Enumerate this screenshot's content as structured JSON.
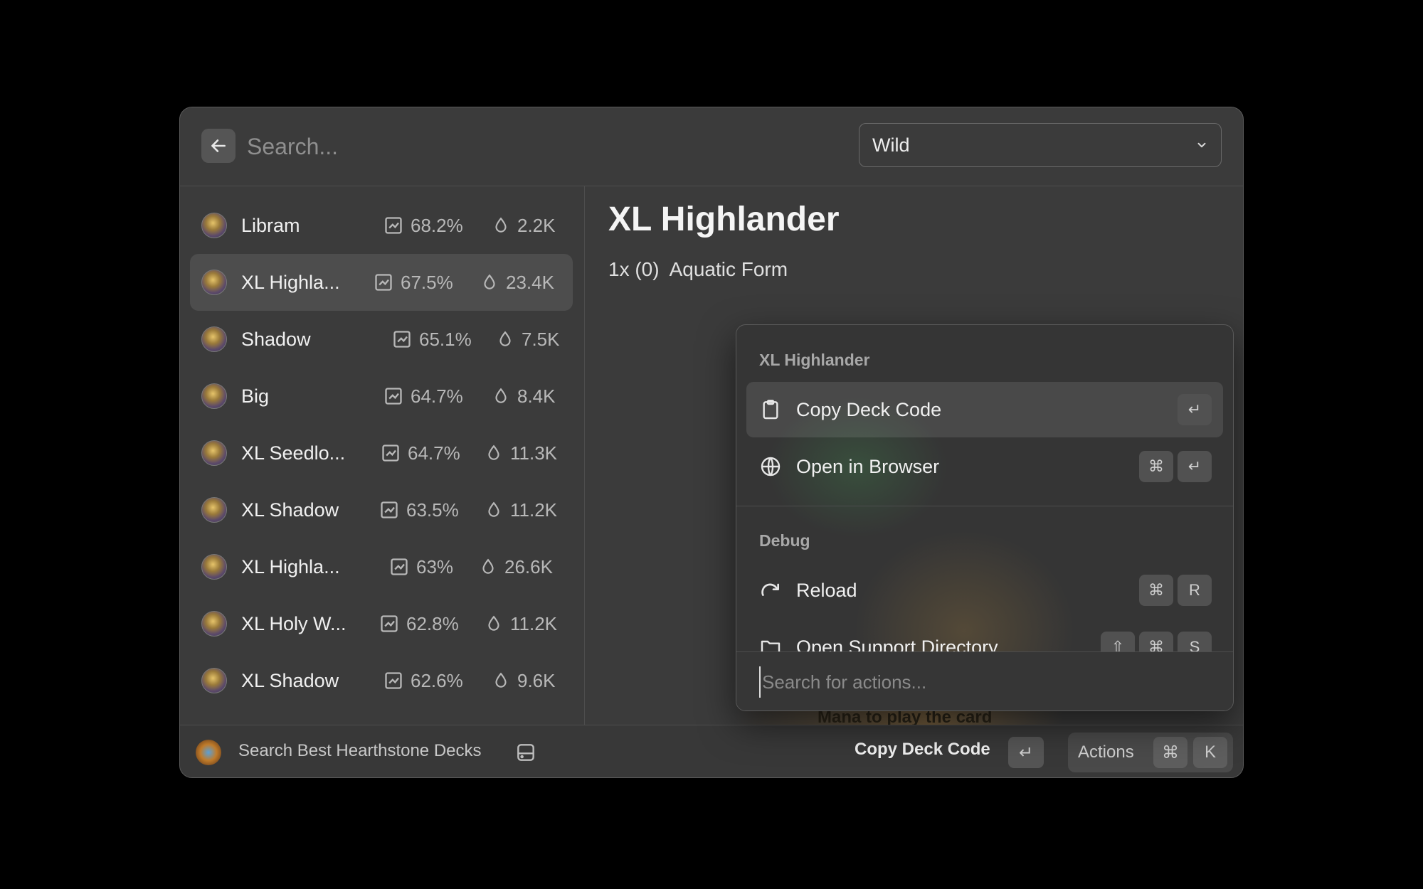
{
  "header": {
    "search_placeholder": "Search...",
    "dropdown_value": "Wild"
  },
  "decks": [
    {
      "name": "Libram",
      "winrate": "68.2%",
      "games": "2.2K"
    },
    {
      "name": "XL Highla...",
      "winrate": "67.5%",
      "games": "23.4K",
      "selected": true
    },
    {
      "name": "Shadow",
      "winrate": "65.1%",
      "games": "7.5K"
    },
    {
      "name": "Big",
      "winrate": "64.7%",
      "games": "8.4K"
    },
    {
      "name": "XL Seedlo...",
      "winrate": "64.7%",
      "games": "11.3K"
    },
    {
      "name": "XL Shadow",
      "winrate": "63.5%",
      "games": "11.2K"
    },
    {
      "name": "XL Highla...",
      "winrate": "63%",
      "games": "26.6K"
    },
    {
      "name": "XL Holy W...",
      "winrate": "62.8%",
      "games": "11.2K"
    },
    {
      "name": "XL Shadow",
      "winrate": "62.6%",
      "games": "9.6K"
    }
  ],
  "detail": {
    "title": "XL Highlander",
    "line": "1x (0)  Aquatic Form",
    "card_peek_text": "Mana to play the card"
  },
  "popover": {
    "section1": "XL Highlander",
    "items1": [
      {
        "label": "Copy Deck Code",
        "keys": [
          "↵"
        ]
      },
      {
        "label": "Open in Browser",
        "keys": [
          "⌘",
          "↵"
        ]
      }
    ],
    "section2": "Debug",
    "items2": [
      {
        "label": "Reload",
        "keys": [
          "⌘",
          "R"
        ]
      },
      {
        "label": "Open Support Directory",
        "keys": [
          "⇧",
          "⌘",
          "S"
        ]
      }
    ],
    "search_placeholder": "Search for actions..."
  },
  "footer": {
    "extension_name": "Search Best Hearthstone Decks",
    "primary_action": "Copy Deck Code",
    "primary_key": "↵",
    "actions_label": "Actions",
    "actions_keys": [
      "⌘",
      "K"
    ]
  },
  "colors": {
    "window_bg": "#3b3b3b",
    "selected_bg": "#4d4d4d",
    "background": "#000000"
  }
}
